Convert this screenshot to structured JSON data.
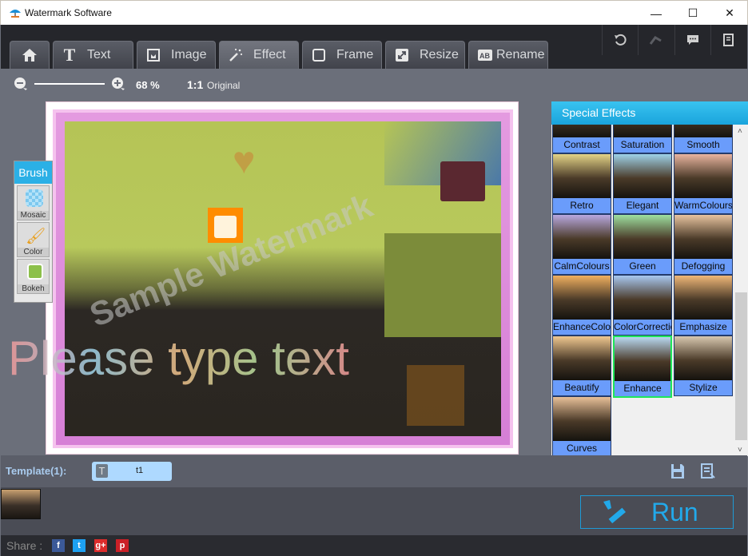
{
  "window": {
    "title": "Watermark Software",
    "minimize": "—",
    "maximize": "☐",
    "close": "✕"
  },
  "tabs": [
    {
      "id": "home",
      "label": "",
      "icon": "home-icon"
    },
    {
      "id": "text",
      "label": "Text",
      "icon": "text-icon"
    },
    {
      "id": "image",
      "label": "Image",
      "icon": "image-icon"
    },
    {
      "id": "effect",
      "label": "Effect",
      "icon": "magic-wand-icon",
      "active": true
    },
    {
      "id": "frame",
      "label": "Frame",
      "icon": "frame-icon"
    },
    {
      "id": "resize",
      "label": "Resize",
      "icon": "resize-icon"
    },
    {
      "id": "rename",
      "label": "Rename",
      "icon": "rename-icon"
    }
  ],
  "top_actions": [
    "undo-icon",
    "redo-icon",
    "feedback-icon",
    "log-icon"
  ],
  "zoom": {
    "percent": "68 %",
    "ratio": "1:1",
    "original_label": "Original",
    "level": 0.68
  },
  "canvas": {
    "text_watermark": "Please type text",
    "diagonal_watermark": "Sample Watermark"
  },
  "brush": {
    "title": "Brush",
    "items": [
      "Mosaic",
      "Color",
      "Bokeh"
    ]
  },
  "effects": {
    "title": "Special Effects",
    "items": [
      "Contrast",
      "Saturation",
      "Smooth",
      "Retro",
      "Elegant",
      "WarmColours",
      "CalmColours",
      "Green",
      "Defogging",
      "EnhanceColor",
      "ColorCorrection",
      "Emphasize",
      "Beautify",
      "Enhance",
      "Stylize",
      "Curves"
    ],
    "selected": "Enhance"
  },
  "template": {
    "label": "Template(1):",
    "name": "t1",
    "badge": "T"
  },
  "run": {
    "label": "Run"
  },
  "share": {
    "label": "Share :",
    "networks": [
      "f",
      "t",
      "g+",
      "p"
    ]
  }
}
